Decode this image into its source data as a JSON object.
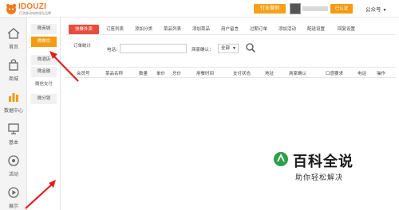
{
  "header": {
    "logo_text": "IDOUZI",
    "logo_tagline": "打造移动电商领先品牌",
    "industry_button": "行业案例",
    "verified_badge": "已认证",
    "account_menu": "公众号"
  },
  "leftnav": {
    "items": [
      {
        "label": "首页",
        "icon": "home-icon"
      },
      {
        "label": "商城",
        "icon": "cart-icon"
      },
      {
        "label": "数据中心",
        "icon": "bar-chart-icon"
      },
      {
        "label": "基本",
        "icon": "monitor-icon"
      },
      {
        "label": "活动",
        "icon": "gift-icon"
      },
      {
        "label": "展示",
        "icon": "play-icon"
      }
    ]
  },
  "subnav": {
    "items": [
      "微商城",
      "微餐饮",
      "微酒店",
      "微金融",
      "微信支付",
      "微分销"
    ],
    "active": "微餐饮"
  },
  "tabs": [
    "快餐外卖",
    "订座列表",
    "添加分类",
    "菜品列表",
    "添加菜品",
    "用户留言",
    "过期订单",
    "添加活动",
    "配送设置",
    "回复设置"
  ],
  "filter": {
    "stat_label": "订单统计",
    "phone_label": "电话：",
    "phone_value": "",
    "confirm_label": "商家确认：",
    "confirm_value": "全部"
  },
  "table": {
    "headers": [
      "会员号",
      "菜品名称",
      "数量",
      "单价",
      "总价",
      "用餐时间",
      "支付状态",
      "地址",
      "商家确认",
      "口感要求",
      "电话",
      "操作"
    ]
  },
  "watermark": {
    "title": "百科全说",
    "subtitle": "助你轻松解决"
  },
  "colors": {
    "accent_orange": "#f39c12",
    "tab_active_red": "#e84c3d",
    "arrow_red": "#e02020"
  }
}
